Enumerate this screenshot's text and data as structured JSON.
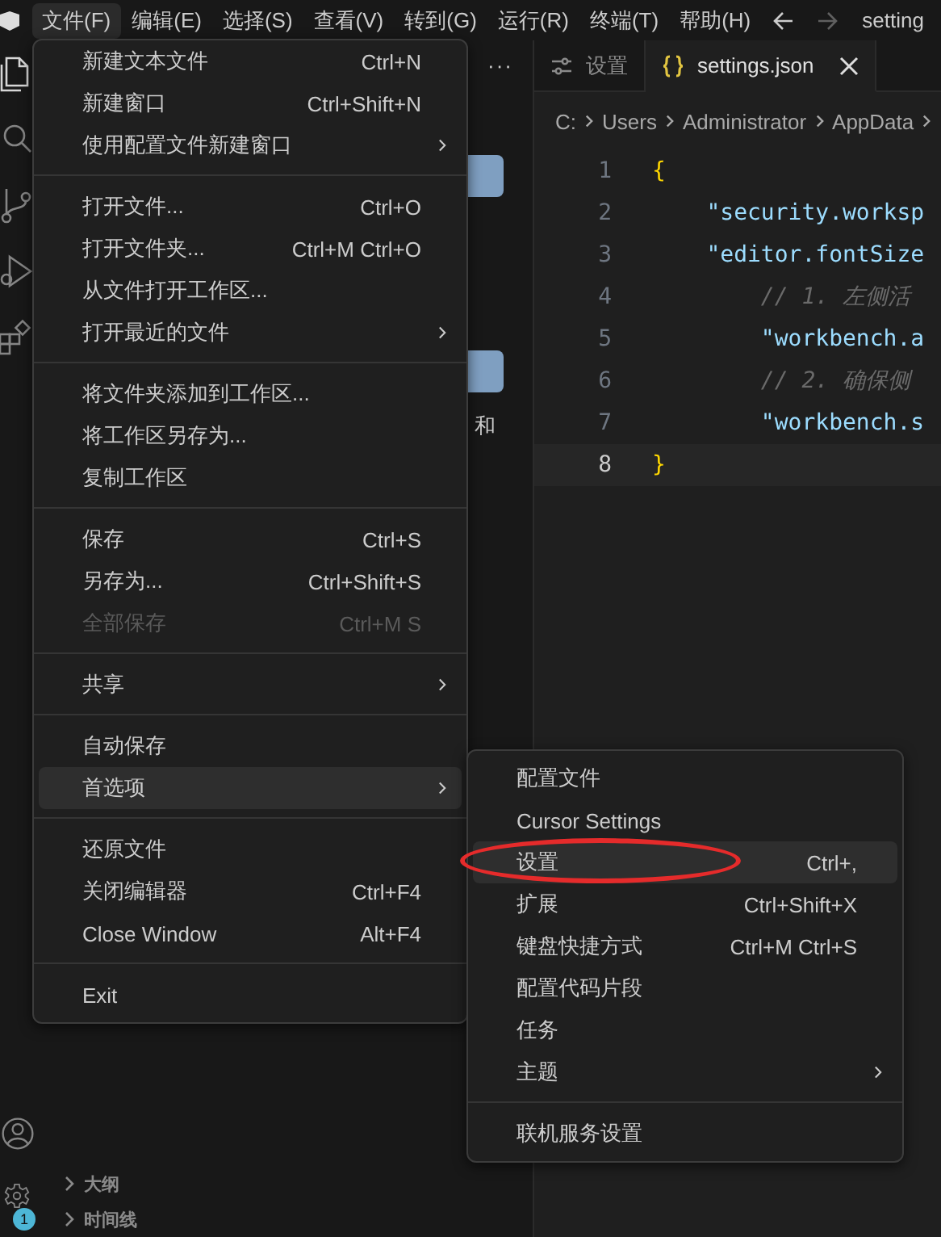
{
  "window": {
    "title": "setting"
  },
  "menubar": {
    "items": [
      {
        "label": "文件(F)",
        "selected": true
      },
      {
        "label": "编辑(E)",
        "selected": false
      },
      {
        "label": "选择(S)",
        "selected": false
      },
      {
        "label": "查看(V)",
        "selected": false
      },
      {
        "label": "转到(G)",
        "selected": false
      },
      {
        "label": "运行(R)",
        "selected": false
      },
      {
        "label": "终端(T)",
        "selected": false
      },
      {
        "label": "帮助(H)",
        "selected": false
      }
    ]
  },
  "activity_bar": {
    "items": [
      {
        "kind": "files",
        "selected": true
      },
      {
        "kind": "search",
        "selected": false
      },
      {
        "kind": "source-control",
        "selected": false
      },
      {
        "kind": "run",
        "selected": false
      },
      {
        "kind": "extensions",
        "selected": false
      }
    ],
    "settings_badge": "1"
  },
  "sidebar": {
    "more": "···",
    "text_fragment": "和",
    "sections": [
      {
        "label": "大纲",
        "expanded": false
      },
      {
        "label": "时间线",
        "expanded": false
      }
    ]
  },
  "editor": {
    "tabs": [
      {
        "kind": "settings",
        "label": "设置",
        "selected": false
      },
      {
        "kind": "json",
        "label": "settings.json",
        "selected": true
      }
    ],
    "breadcrumb": [
      "C:",
      "Users",
      "Administrator",
      "AppData"
    ],
    "lines": [
      {
        "number": "1",
        "kind": "brace",
        "text": "{",
        "current": false
      },
      {
        "number": "2",
        "kind": "key",
        "text": "    \"security.worksp",
        "current": false
      },
      {
        "number": "3",
        "kind": "key",
        "text": "    \"editor.fontSize",
        "current": false
      },
      {
        "number": "4",
        "kind": "comment",
        "text": "        // 1. 左侧活",
        "current": false
      },
      {
        "number": "5",
        "kind": "key",
        "text": "        \"workbench.a",
        "current": false
      },
      {
        "number": "6",
        "kind": "comment",
        "text": "        // 2. 确保侧",
        "current": false
      },
      {
        "number": "7",
        "kind": "key",
        "text": "        \"workbench.s",
        "current": false
      },
      {
        "number": "8",
        "kind": "brace",
        "text": "}",
        "current": true
      }
    ]
  },
  "file_menu": {
    "groups": [
      [
        {
          "label": "新建文本文件",
          "shortcut": "Ctrl+N",
          "submenu": false,
          "disabled": false,
          "selected": false
        },
        {
          "label": "新建窗口",
          "shortcut": "Ctrl+Shift+N",
          "submenu": false,
          "disabled": false,
          "selected": false
        },
        {
          "label": "使用配置文件新建窗口",
          "submenu": true,
          "disabled": false,
          "selected": false
        }
      ],
      [
        {
          "label": "打开文件...",
          "shortcut": "Ctrl+O",
          "submenu": false,
          "disabled": false,
          "selected": false
        },
        {
          "label": "打开文件夹...",
          "shortcut": "Ctrl+M Ctrl+O",
          "submenu": false,
          "disabled": false,
          "selected": false
        },
        {
          "label": "从文件打开工作区...",
          "submenu": false,
          "disabled": false,
          "selected": false
        },
        {
          "label": "打开最近的文件",
          "submenu": true,
          "disabled": false,
          "selected": false
        }
      ],
      [
        {
          "label": "将文件夹添加到工作区...",
          "submenu": false,
          "disabled": false,
          "selected": false
        },
        {
          "label": "将工作区另存为...",
          "submenu": false,
          "disabled": false,
          "selected": false
        },
        {
          "label": "复制工作区",
          "submenu": false,
          "disabled": false,
          "selected": false
        }
      ],
      [
        {
          "label": "保存",
          "shortcut": "Ctrl+S",
          "submenu": false,
          "disabled": false,
          "selected": false
        },
        {
          "label": "另存为...",
          "shortcut": "Ctrl+Shift+S",
          "submenu": false,
          "disabled": false,
          "selected": false
        },
        {
          "label": "全部保存",
          "shortcut": "Ctrl+M S",
          "submenu": false,
          "disabled": true,
          "selected": false
        }
      ],
      [
        {
          "label": "共享",
          "submenu": true,
          "disabled": false,
          "selected": false
        }
      ],
      [
        {
          "label": "自动保存",
          "submenu": false,
          "disabled": false,
          "selected": false
        },
        {
          "label": "首选项",
          "submenu": true,
          "disabled": false,
          "selected": true
        }
      ],
      [
        {
          "label": "还原文件",
          "submenu": false,
          "disabled": false,
          "selected": false
        },
        {
          "label": "关闭编辑器",
          "shortcut": "Ctrl+F4",
          "submenu": false,
          "disabled": false,
          "selected": false
        },
        {
          "label": "Close Window",
          "shortcut": "Alt+F4",
          "submenu": false,
          "disabled": false,
          "selected": false
        }
      ],
      [
        {
          "label": "Exit",
          "submenu": false,
          "disabled": false,
          "selected": false
        }
      ]
    ]
  },
  "preferences_menu": {
    "groups": [
      [
        {
          "label": "配置文件",
          "submenu": false,
          "selected": false,
          "circled": false
        },
        {
          "label": "Cursor Settings",
          "submenu": false,
          "selected": false,
          "circled": false
        },
        {
          "label": "设置",
          "shortcut": "Ctrl+,",
          "submenu": false,
          "selected": true,
          "circled": true
        },
        {
          "label": "扩展",
          "shortcut": "Ctrl+Shift+X",
          "submenu": false,
          "selected": false,
          "circled": false
        },
        {
          "label": "键盘快捷方式",
          "shortcut": "Ctrl+M Ctrl+S",
          "submenu": false,
          "selected": false,
          "circled": false
        },
        {
          "label": "配置代码片段",
          "submenu": false,
          "selected": false,
          "circled": false
        },
        {
          "label": "任务",
          "submenu": false,
          "selected": false,
          "circled": false
        },
        {
          "label": "主题",
          "submenu": true,
          "selected": false,
          "circled": false
        }
      ],
      [
        {
          "label": "联机服务设置",
          "submenu": false,
          "selected": false,
          "circled": false
        }
      ]
    ]
  }
}
